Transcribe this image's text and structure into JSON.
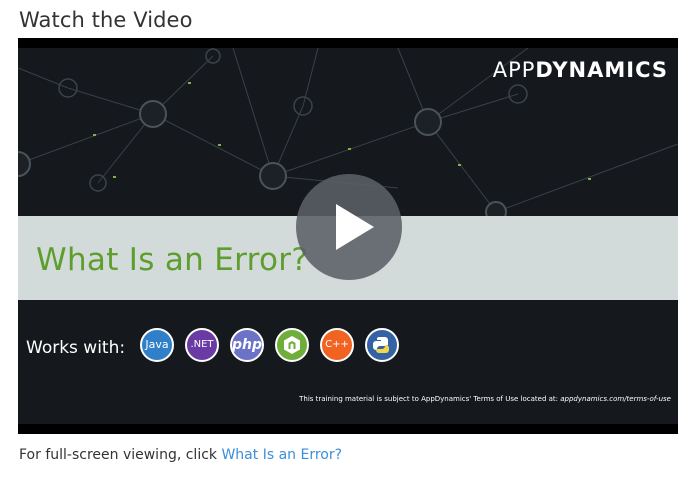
{
  "section": {
    "heading": "Watch the Video"
  },
  "video": {
    "brand": {
      "prefix": "APP",
      "suffix": "DYNAMICS"
    },
    "title": "What Is an Error?",
    "works_with_label": "Works with:",
    "languages": [
      {
        "label": "Java",
        "icon": "java-icon",
        "color": "#2f7fc9"
      },
      {
        "label": ".NET",
        "icon": "dotnet-icon",
        "color": "#6a3ba4"
      },
      {
        "label": "php",
        "icon": "php-icon",
        "color": "#6c72c6"
      },
      {
        "label": "",
        "icon": "nodejs-icon",
        "color": "#6fae3a"
      },
      {
        "label": "C++",
        "icon": "cpp-icon",
        "color": "#f06321"
      },
      {
        "label": "",
        "icon": "python-icon",
        "color": "#3463a5"
      }
    ],
    "terms": {
      "text": "This training material is subject to AppDynamics' Terms of Use located at: ",
      "link": "appdynamics.com/terms-of-use"
    },
    "play_icon": "play-icon",
    "title_color": "#5e9e2e"
  },
  "caption": {
    "text": "For full-screen viewing, click ",
    "link": "What Is an Error?",
    "link_color": "#3c8ed8"
  }
}
